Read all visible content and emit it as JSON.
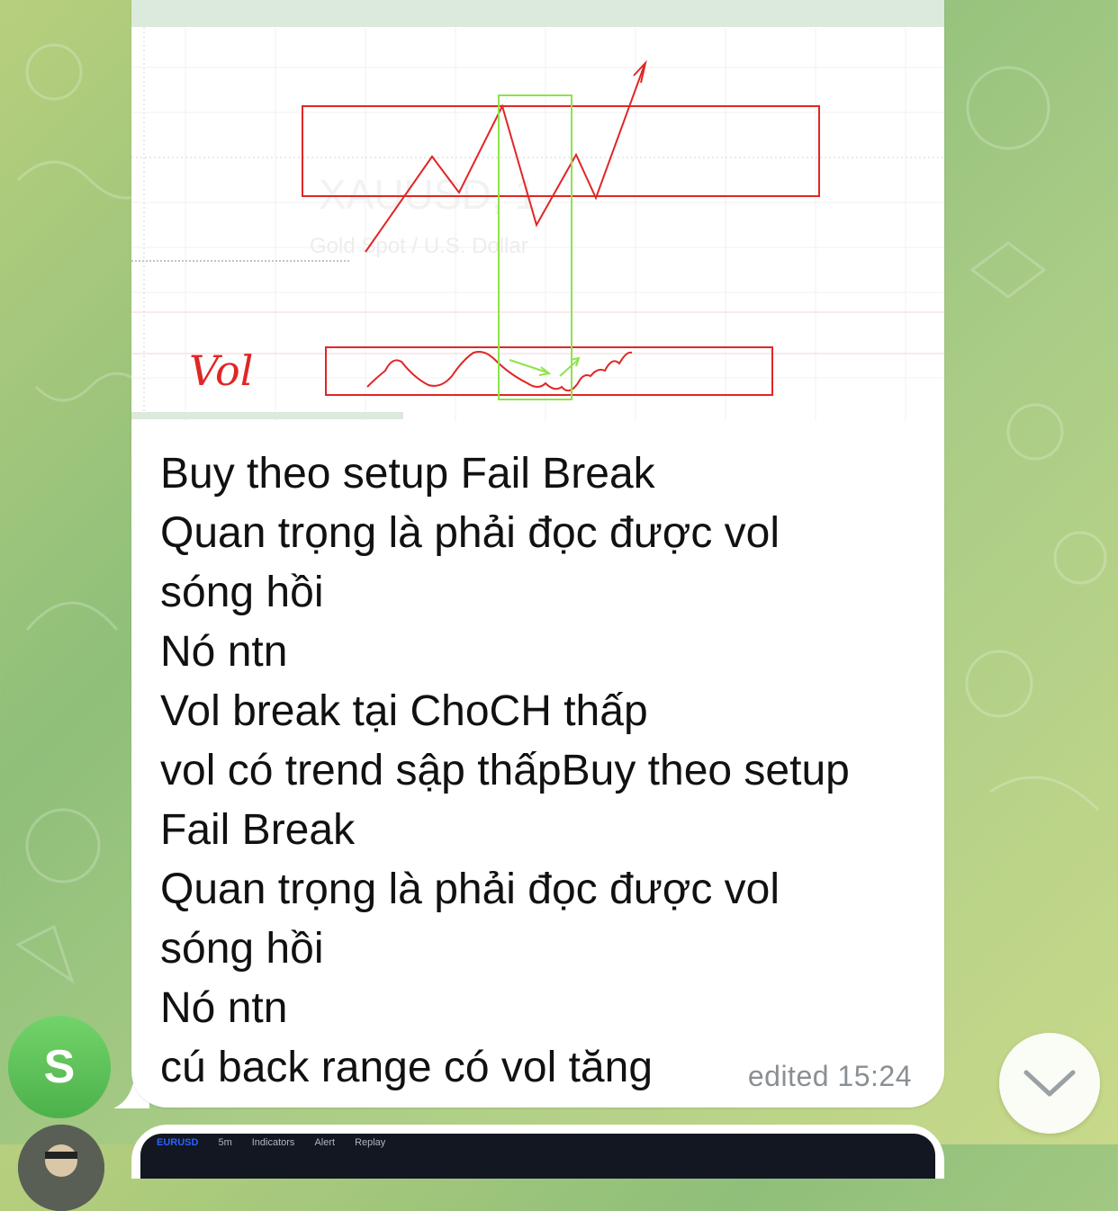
{
  "message": {
    "text": "Buy theo setup Fail Break\nQuan trọng là phải đọc được vol\nsóng hồi\nNó ntn\nVol break tại ChoCH thấp\nvol có trend sập thấpBuy theo setup\nFail Break\nQuan trọng là phải đọc được vol\nsóng hồi\nNó ntn\ncú back range có vol tăng",
    "meta": "edited 15:24"
  },
  "attachment": {
    "watermark_symbol": "XAUUSD, 1",
    "watermark_name": "Gold Spot / U.S. Dollar",
    "annotation": "Vol"
  },
  "sender": {
    "avatar_initial": "S"
  },
  "next_message": {
    "toolbar": [
      "EURUSD",
      "5m",
      "Indicators",
      "Alert",
      "Replay"
    ]
  },
  "colors": {
    "drawing_red": "#e02626",
    "highlight_green": "#8fe34a",
    "avatar_green": "#5cc257",
    "meta_gray": "#8a8f93"
  },
  "icons": [
    "chevron-down-icon"
  ]
}
